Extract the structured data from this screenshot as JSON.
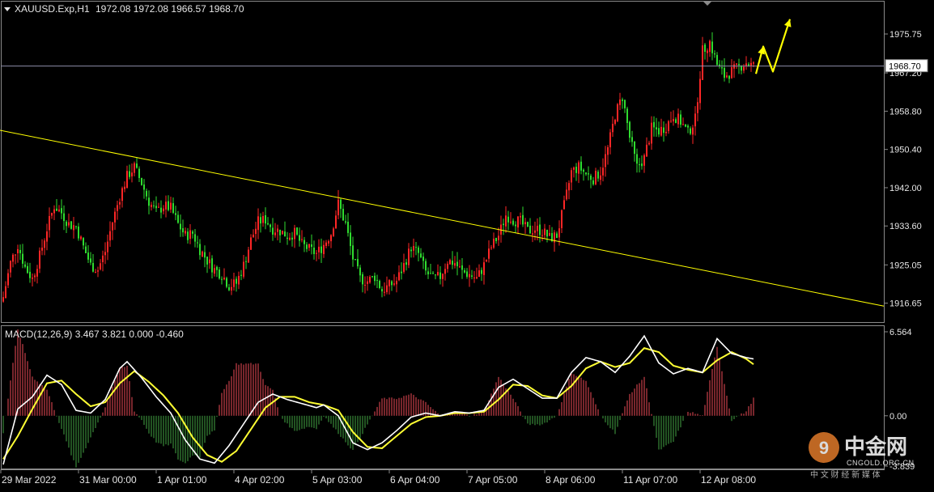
{
  "header": {
    "symbol": "XAUUSD.Exp,H1",
    "ohlc": "1972.08 1972.08 1966.57 1968.70",
    "menu_icon": "triangle-down-icon"
  },
  "price_axis": {
    "ticks": [
      "1975.75",
      "1967.20",
      "1958.80",
      "1950.40",
      "1942.00",
      "1933.60",
      "1925.05",
      "1916.65"
    ],
    "tick_values": [
      1975.75,
      1967.2,
      1958.8,
      1950.4,
      1942.0,
      1933.6,
      1925.05,
      1916.65
    ],
    "current_price_label": "1968.70",
    "current_price": 1968.7,
    "range": [
      1912.5,
      1982.5
    ]
  },
  "macd": {
    "title": "MACD(12,26,9) 3.467 3.821 0.000 -0.460",
    "axis_ticks": [
      "6.564",
      "0.00",
      "-3.839"
    ],
    "range": [
      -3.839,
      6.564
    ]
  },
  "time_axis": {
    "labels": [
      "29 Mar 2022",
      "31 Mar 00:00",
      "1 Apr 01:00",
      "4 Apr 02:00",
      "5 Apr 03:00",
      "6 Apr 04:00",
      "7 Apr 05:00",
      "8 Apr 06:00",
      "11 Apr 07:00",
      "12 Apr 08:00"
    ]
  },
  "watermark": {
    "brand": "中金网",
    "url": "CNGOLD.ORG.CN",
    "tagline": "中 文 财 经 新 媒 体"
  },
  "colors": {
    "background": "#000000",
    "bull": "#ff2626",
    "bear": "#2fdc2f",
    "trendline": "#ffff00",
    "forecast": "#ffff00",
    "macd_main": "#ffffff",
    "macd_signal": "#ffff33",
    "hist_pos": "#c8404a",
    "hist_neg": "#3a8a3a",
    "grid": "#8a8a8a",
    "text": "#e6e6e6"
  },
  "chart_data": {
    "type": "candlestick",
    "symbol": "XAUUSD.Exp",
    "timeframe": "H1",
    "y_range": [
      1912.5,
      1982.5
    ],
    "close_path": [
      [
        0,
        1918.0
      ],
      [
        3,
        1925.5
      ],
      [
        6,
        1929.5
      ],
      [
        9,
        1924.5
      ],
      [
        12,
        1922.0
      ],
      [
        15,
        1927.0
      ],
      [
        18,
        1933.0
      ],
      [
        21,
        1938.0
      ],
      [
        24,
        1936.5
      ],
      [
        27,
        1934.0
      ],
      [
        30,
        1933.5
      ],
      [
        33,
        1929.0
      ],
      [
        36,
        1925.0
      ],
      [
        39,
        1924.0
      ],
      [
        42,
        1928.0
      ],
      [
        45,
        1934.5
      ],
      [
        48,
        1940.0
      ],
      [
        51,
        1944.5
      ],
      [
        54,
        1946.5
      ],
      [
        57,
        1943.0
      ],
      [
        60,
        1939.0
      ],
      [
        63,
        1936.5
      ],
      [
        66,
        1938.0
      ],
      [
        69,
        1937.5
      ],
      [
        72,
        1934.0
      ],
      [
        75,
        1931.5
      ],
      [
        78,
        1932.0
      ],
      [
        81,
        1928.5
      ],
      [
        84,
        1926.0
      ],
      [
        87,
        1924.0
      ],
      [
        90,
        1923.0
      ],
      [
        93,
        1920.5
      ],
      [
        96,
        1921.0
      ],
      [
        99,
        1925.0
      ],
      [
        102,
        1930.5
      ],
      [
        105,
        1934.5
      ],
      [
        108,
        1935.0
      ],
      [
        111,
        1933.0
      ],
      [
        114,
        1932.5
      ],
      [
        117,
        1931.5
      ],
      [
        120,
        1932.0
      ],
      [
        123,
        1929.5
      ],
      [
        126,
        1928.5
      ],
      [
        129,
        1927.5
      ],
      [
        132,
        1929.5
      ],
      [
        135,
        1932.0
      ],
      [
        138,
        1938.5
      ],
      [
        141,
        1934.0
      ],
      [
        144,
        1926.5
      ],
      [
        147,
        1922.0
      ],
      [
        150,
        1921.5
      ],
      [
        153,
        1922.5
      ],
      [
        156,
        1919.5
      ],
      [
        159,
        1920.5
      ],
      [
        162,
        1921.5
      ],
      [
        165,
        1925.0
      ],
      [
        168,
        1929.0
      ],
      [
        171,
        1927.5
      ],
      [
        174,
        1923.5
      ],
      [
        177,
        1922.0
      ],
      [
        180,
        1922.5
      ],
      [
        183,
        1926.0
      ],
      [
        186,
        1925.5
      ],
      [
        189,
        1923.5
      ],
      [
        192,
        1923.0
      ],
      [
        195,
        1922.0
      ],
      [
        198,
        1925.0
      ],
      [
        201,
        1929.0
      ],
      [
        204,
        1931.5
      ],
      [
        207,
        1936.0
      ],
      [
        210,
        1935.0
      ],
      [
        213,
        1934.5
      ],
      [
        216,
        1932.5
      ],
      [
        219,
        1933.0
      ],
      [
        222,
        1932.5
      ],
      [
        225,
        1931.0
      ],
      [
        228,
        1931.5
      ],
      [
        231,
        1938.0
      ],
      [
        234,
        1945.5
      ],
      [
        237,
        1946.5
      ],
      [
        240,
        1945.0
      ],
      [
        243,
        1944.0
      ],
      [
        246,
        1945.5
      ],
      [
        249,
        1950.5
      ],
      [
        252,
        1958.0
      ],
      [
        255,
        1962.0
      ],
      [
        258,
        1953.0
      ],
      [
        261,
        1946.5
      ],
      [
        264,
        1948.5
      ],
      [
        267,
        1955.0
      ],
      [
        270,
        1954.5
      ],
      [
        273,
        1955.5
      ],
      [
        276,
        1958.0
      ],
      [
        279,
        1956.5
      ],
      [
        282,
        1954.0
      ],
      [
        285,
        1957.0
      ],
      [
        288,
        1972.0
      ],
      [
        291,
        1974.0
      ],
      [
        294,
        1969.0
      ],
      [
        297,
        1966.5
      ],
      [
        300,
        1967.5
      ],
      [
        303,
        1968.5
      ],
      [
        306,
        1969.5
      ],
      [
        309,
        1968.7
      ]
    ],
    "trendline": [
      [
        0,
        1954.6
      ],
      [
        330,
        1916.0
      ]
    ],
    "forecast_arrow": [
      [
        310,
        1967.0
      ],
      [
        313,
        1973.0
      ],
      [
        317,
        1967.5
      ],
      [
        324,
        1979.0
      ]
    ],
    "macd": {
      "zero": 0,
      "main": [
        [
          0,
          -3.6
        ],
        [
          6,
          0.5
        ],
        [
          12,
          1.4
        ],
        [
          18,
          3.0
        ],
        [
          24,
          2.3
        ],
        [
          30,
          0.4
        ],
        [
          36,
          0.2
        ],
        [
          42,
          1.2
        ],
        [
          48,
          3.5
        ],
        [
          51,
          4.0
        ],
        [
          57,
          2.8
        ],
        [
          63,
          1.4
        ],
        [
          69,
          0.2
        ],
        [
          75,
          -1.8
        ],
        [
          81,
          -3.2
        ],
        [
          87,
          -3.5
        ],
        [
          93,
          -2.2
        ],
        [
          99,
          -0.6
        ],
        [
          105,
          1.0
        ],
        [
          111,
          1.6
        ],
        [
          117,
          1.2
        ],
        [
          123,
          0.9
        ],
        [
          129,
          0.6
        ],
        [
          132,
          0.8
        ],
        [
          138,
          0.0
        ],
        [
          144,
          -2.0
        ],
        [
          150,
          -2.5
        ],
        [
          156,
          -2.0
        ],
        [
          162,
          -1.1
        ],
        [
          168,
          -0.1
        ],
        [
          174,
          0.2
        ],
        [
          180,
          0.0
        ],
        [
          186,
          0.3
        ],
        [
          192,
          0.2
        ],
        [
          198,
          0.4
        ],
        [
          204,
          2.1
        ],
        [
          210,
          2.7
        ],
        [
          216,
          2.0
        ],
        [
          222,
          1.3
        ],
        [
          228,
          1.3
        ],
        [
          234,
          3.2
        ],
        [
          240,
          4.3
        ],
        [
          246,
          4.0
        ],
        [
          252,
          3.2
        ],
        [
          258,
          4.4
        ],
        [
          264,
          5.9
        ],
        [
          270,
          3.9
        ],
        [
          276,
          3.1
        ],
        [
          282,
          3.5
        ],
        [
          288,
          3.2
        ],
        [
          294,
          5.7
        ],
        [
          300,
          4.6
        ],
        [
          306,
          4.3
        ],
        [
          309,
          4.2
        ]
      ],
      "signal": [
        [
          0,
          -3.2
        ],
        [
          6,
          -1.5
        ],
        [
          12,
          0.5
        ],
        [
          18,
          2.4
        ],
        [
          24,
          2.6
        ],
        [
          30,
          1.6
        ],
        [
          36,
          0.7
        ],
        [
          42,
          1.0
        ],
        [
          48,
          2.4
        ],
        [
          54,
          3.3
        ],
        [
          60,
          2.5
        ],
        [
          66,
          1.5
        ],
        [
          72,
          0.2
        ],
        [
          78,
          -1.6
        ],
        [
          84,
          -2.9
        ],
        [
          90,
          -3.4
        ],
        [
          96,
          -2.6
        ],
        [
          102,
          -1.0
        ],
        [
          108,
          0.6
        ],
        [
          114,
          1.4
        ],
        [
          120,
          1.4
        ],
        [
          126,
          1.0
        ],
        [
          132,
          0.8
        ],
        [
          138,
          0.4
        ],
        [
          144,
          -1.2
        ],
        [
          150,
          -2.3
        ],
        [
          156,
          -2.4
        ],
        [
          162,
          -1.5
        ],
        [
          168,
          -0.6
        ],
        [
          174,
          -0.1
        ],
        [
          180,
          0.0
        ],
        [
          186,
          0.2
        ],
        [
          192,
          0.2
        ],
        [
          198,
          0.3
        ],
        [
          204,
          1.2
        ],
        [
          210,
          2.3
        ],
        [
          216,
          2.2
        ],
        [
          222,
          1.5
        ],
        [
          228,
          1.3
        ],
        [
          234,
          2.2
        ],
        [
          240,
          3.5
        ],
        [
          246,
          4.0
        ],
        [
          252,
          3.6
        ],
        [
          258,
          3.9
        ],
        [
          264,
          5.0
        ],
        [
          270,
          4.7
        ],
        [
          276,
          3.7
        ],
        [
          282,
          3.4
        ],
        [
          288,
          3.2
        ],
        [
          294,
          4.1
        ],
        [
          300,
          4.7
        ],
        [
          306,
          4.2
        ],
        [
          309,
          3.8
        ]
      ]
    }
  }
}
